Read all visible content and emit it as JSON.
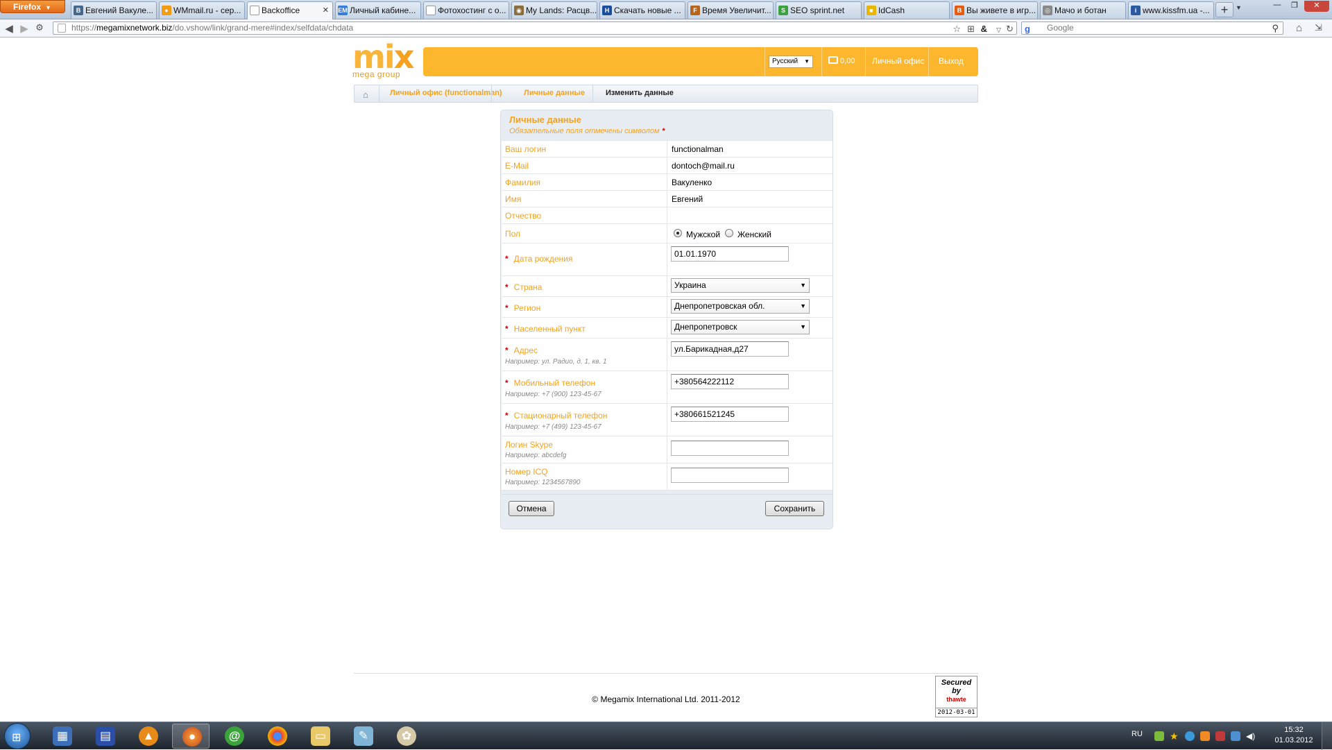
{
  "browser": {
    "menu_button": "Firefox",
    "tabs": [
      {
        "label": "Евгений Вакуле...",
        "icon_text": "В",
        "icon_color": "#45688e"
      },
      {
        "label": "WMmail.ru - сер...",
        "icon_text": "●",
        "icon_color": "#f39c12"
      },
      {
        "label": "Backoffice",
        "icon_text": "",
        "icon_color": "#ffffff"
      },
      {
        "label": "Личный кабине...",
        "icon_text": "EM",
        "icon_color": "#3a7bd5"
      },
      {
        "label": "Фотохостинг с о...",
        "icon_text": "",
        "icon_color": "#ffffff"
      },
      {
        "label": "My Lands: Расцв...",
        "icon_text": "◉",
        "icon_color": "#8a6d3b"
      },
      {
        "label": "Скачать новые ...",
        "icon_text": "Н",
        "icon_color": "#1b4f9c"
      },
      {
        "label": "Время Увеличит...",
        "icon_text": "F",
        "icon_color": "#b5651d"
      },
      {
        "label": "SEO sprint.net",
        "icon_text": "S",
        "icon_color": "#3ca241"
      },
      {
        "label": "IdCash",
        "icon_text": "■",
        "icon_color": "#e8b500"
      },
      {
        "label": "Вы живете в игр...",
        "icon_text": "B",
        "icon_color": "#e25d12"
      },
      {
        "label": "Мачо и ботан",
        "icon_text": "◎",
        "icon_color": "#888888"
      },
      {
        "label": "www.kissfm.ua -...",
        "icon_text": "i",
        "icon_color": "#2c5aa0"
      }
    ],
    "new_tab": "+",
    "url_scheme": "https://",
    "url_host": "megamixnetwork.biz",
    "url_path": "/do.vshow/link/grand-mere#index/selfdata/chdata",
    "search_engine_glyph": "g",
    "search_placeholder": "Google"
  },
  "site": {
    "logo_text_m": "mi",
    "logo_text_x": "x",
    "logo_subtitle": "mega group",
    "language": "Русский",
    "cart_amount": "0,00",
    "nav_office": "Личный офис",
    "nav_logout": "Выход",
    "breadcrumb": [
      "Личный офис (functionalman)",
      "Личные данные",
      "Изменить данные"
    ]
  },
  "form": {
    "title": "Личные данные",
    "note": "Обязательные поля отмечены символом",
    "required_mark": "*",
    "login_label": "Ваш логин",
    "login_value": "functionalman",
    "email_label": "E-Mail",
    "email_value": "dontoch@mail.ru",
    "lastname_label": "Фамилия",
    "lastname_value": "Вакуленко",
    "firstname_label": "Имя",
    "firstname_value": "Евгений",
    "middlename_label": "Отчество",
    "middlename_value": "",
    "gender_label": "Пол",
    "gender_male": "Мужской",
    "gender_female": "Женский",
    "gender_selected": "male",
    "birthdate_label": "Дата рождения",
    "birthdate_value": "01.01.1970",
    "country_label": "Страна",
    "country_value": "Украина",
    "region_label": "Регион",
    "region_value": "Днепропетровская обл.",
    "city_label": "Населенный пункт",
    "city_value": "Днепропетровск",
    "address_label": "Адрес",
    "address_hint": "Например: ул. Радио, д. 1, кв. 1",
    "address_value": "ул.Барикадная,д27",
    "mobile_label": "Мобильный телефон",
    "mobile_hint": "Например: +7 (900) 123-45-67",
    "mobile_value": "+380564222112",
    "landline_label": "Стационарный телефон",
    "landline_hint": "Например: +7 (499) 123-45-67",
    "landline_value": "+380661521245",
    "skype_label": "Логин Skype",
    "skype_hint": "Например: abcdefg",
    "skype_value": "",
    "icq_label": "Номер ICQ",
    "icq_hint": "Например: 1234567890",
    "icq_value": "",
    "cancel_label": "Отмена",
    "save_label": "Сохранить"
  },
  "footer": {
    "copyright": "© Megamix International Ltd. 2011-2012",
    "seal_line1": "Secured",
    "seal_line2": "by",
    "seal_brand": "thawte",
    "seal_date": "2012-03-01"
  },
  "taskbar": {
    "language": "RU",
    "time": "15:32",
    "date": "01.03.2012"
  }
}
